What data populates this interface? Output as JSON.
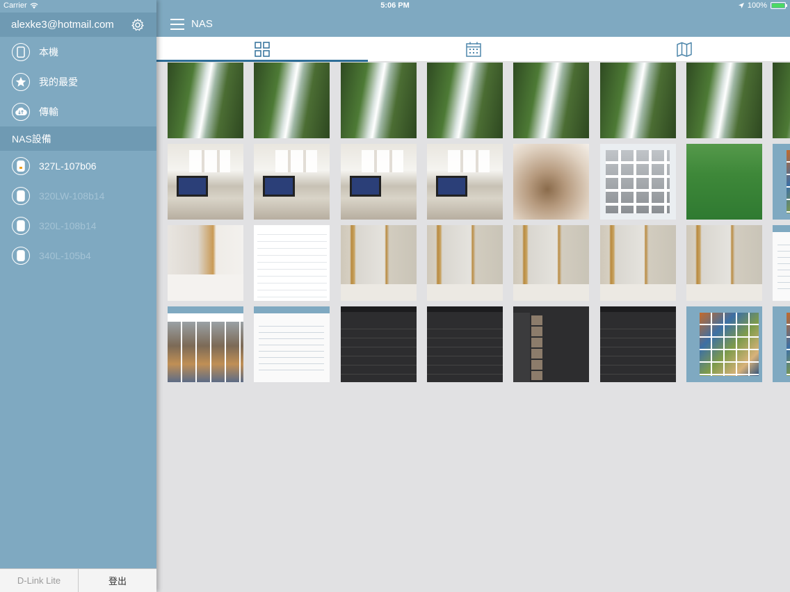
{
  "status_bar": {
    "carrier": "Carrier",
    "time": "5:06 PM",
    "battery": "100%",
    "battery_level": 1.0
  },
  "sidebar": {
    "account": "alexke3@hotmail.com",
    "items": [
      {
        "label": "本機",
        "icon": "phone-icon"
      },
      {
        "label": "我的最愛",
        "icon": "star-icon"
      },
      {
        "label": "傳輸",
        "icon": "cloud-transfer-icon"
      }
    ],
    "section_title": "NAS設備",
    "devices": [
      {
        "label": "327L-107b06",
        "enabled": true
      },
      {
        "label": "320LW-108b14",
        "enabled": false
      },
      {
        "label": "320L-108b14",
        "enabled": false
      },
      {
        "label": "340L-105b4",
        "enabled": false
      }
    ],
    "footer": {
      "left": "D-Link Lite",
      "right": "登出"
    }
  },
  "header": {
    "title": "NAS"
  },
  "tabs": [
    {
      "name": "grid-view",
      "icon": "grid-icon",
      "active": true
    },
    {
      "name": "calendar-view",
      "icon": "calendar-icon",
      "active": false
    },
    {
      "name": "map-view",
      "icon": "map-icon",
      "active": false
    }
  ],
  "photos": [
    "waterfall",
    "waterfall",
    "waterfall",
    "waterfall",
    "waterfall",
    "waterfall",
    "waterfall",
    "waterfall",
    "office",
    "office",
    "office",
    "office",
    "blur",
    "screen-grid",
    "grass",
    "screen-mosaic",
    "doorway",
    "screen-list",
    "door",
    "door",
    "door",
    "door",
    "door",
    "screen-light",
    "screen-photos",
    "screen-light",
    "screen-dark",
    "screen-dark",
    "screen-mixed",
    "screen-dark",
    "screen-mosaic",
    "screen-mosaic"
  ]
}
